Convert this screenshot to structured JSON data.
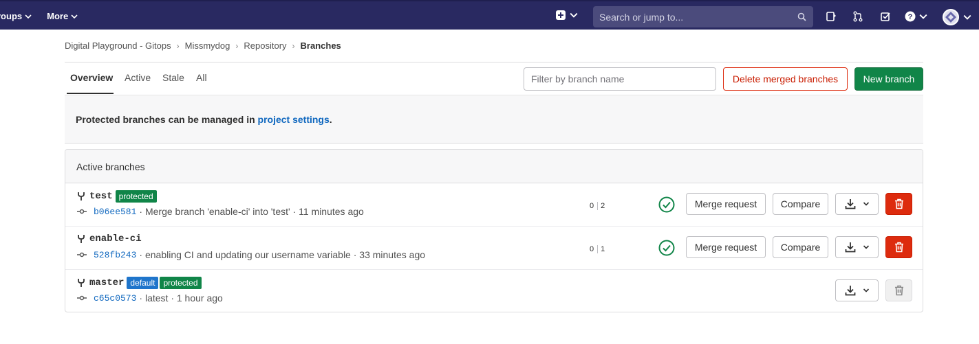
{
  "navbar": {
    "groups_label": "roups",
    "more_label": "More",
    "search_placeholder": "Search or jump to..."
  },
  "breadcrumb": {
    "items": [
      "Digital Playground - Gitops",
      "Missmydog",
      "Repository"
    ],
    "current": "Branches",
    "separator": "›"
  },
  "tabs": {
    "overview": "Overview",
    "active": "Active",
    "stale": "Stale",
    "all": "All"
  },
  "toolbar": {
    "filter_placeholder": "Filter by branch name",
    "delete_merged_label": "Delete merged branches",
    "new_branch_label": "New branch"
  },
  "info": {
    "text": "Protected branches can be managed in ",
    "link": "project settings",
    "suffix": "."
  },
  "card": {
    "header": "Active branches",
    "branches": [
      {
        "name": "test",
        "badges": [
          "protected"
        ],
        "sha": "b06ee581",
        "message": "· Merge branch 'enable-ci' into 'test' · 11 minutes ago",
        "behind": "0",
        "ahead": "2",
        "merge_label": "Merge request",
        "compare_label": "Compare"
      },
      {
        "name": "enable-ci",
        "badges": [],
        "sha": "528fb243",
        "message": "· enabling CI and updating our username variable · 33 minutes ago",
        "behind": "0",
        "ahead": "1",
        "merge_label": "Merge request",
        "compare_label": "Compare"
      },
      {
        "name": "master",
        "badges": [
          "default",
          "protected"
        ],
        "sha": "c65c0573",
        "message": "· latest · 1 hour ago"
      }
    ]
  },
  "colors": {
    "navbar": "#292961",
    "success": "#108548",
    "danger": "#dd2b0e",
    "link": "#1068bf",
    "default_badge": "#1f75cb"
  }
}
